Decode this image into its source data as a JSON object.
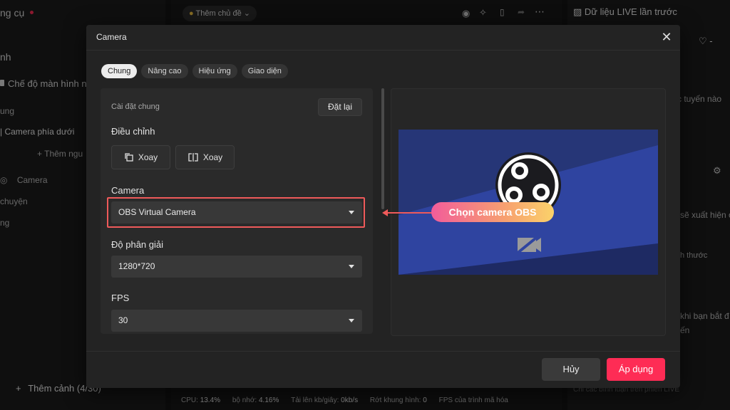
{
  "background": {
    "left": {
      "header": "ng cụ",
      "section": "nh",
      "checkbox_label": "Chế độ màn hình ng",
      "item1": "ung",
      "item2": "| Camera phía dưới",
      "add_source": "Thêm ngu",
      "camera_item": "Camera",
      "item3": "chuyện",
      "item4": "ng",
      "add_scene": "Thêm cảnh (4/30)"
    },
    "center": {
      "topic_button": "Thêm chủ đề",
      "stats": {
        "cpu": "CPU:",
        "cpu_val": "13.4%",
        "mem": "bộ nhớ:",
        "mem_val": "4.16%",
        "upload": "Tải lên kb/giây:",
        "upload_val": "0kb/s",
        "dropped": "Rớt khung hình:",
        "dropped_val": "0",
        "fps": "FPS của trình mã hóa"
      }
    },
    "right": {
      "title": "Dữ liệu LIVE lần trước",
      "likes": "-",
      "text1": "c tuyến nào",
      "text2": "sẽ xuất hiện ở",
      "text3": "h thước",
      "text4": "khi bạn bắt đ",
      "text5": "ến",
      "comment_placeholder": "Chỉ các bình luận trên phiên LIVE"
    }
  },
  "modal": {
    "title": "Camera",
    "tabs": [
      {
        "label": "Chung",
        "active": true
      },
      {
        "label": "Nâng cao",
        "active": false
      },
      {
        "label": "Hiệu ứng",
        "active": false
      },
      {
        "label": "Giao diện",
        "active": false
      }
    ],
    "settings": {
      "heading": "Cài đặt chung",
      "reset_label": "Đặt lại",
      "adjust_label": "Điều chỉnh",
      "rotate_left_label": "Xoay",
      "rotate_right_label": "Xoay",
      "camera_label": "Camera",
      "camera_value": "OBS Virtual Camera",
      "resolution_label": "Độ phân giải",
      "resolution_value": "1280*720",
      "fps_label": "FPS",
      "fps_value": "30"
    },
    "callout": "Chọn camera OBS",
    "cancel_label": "Hủy",
    "apply_label": "Áp dụng"
  },
  "colors": {
    "accent": "#fe2c55",
    "highlight": "#ef5a5a"
  }
}
